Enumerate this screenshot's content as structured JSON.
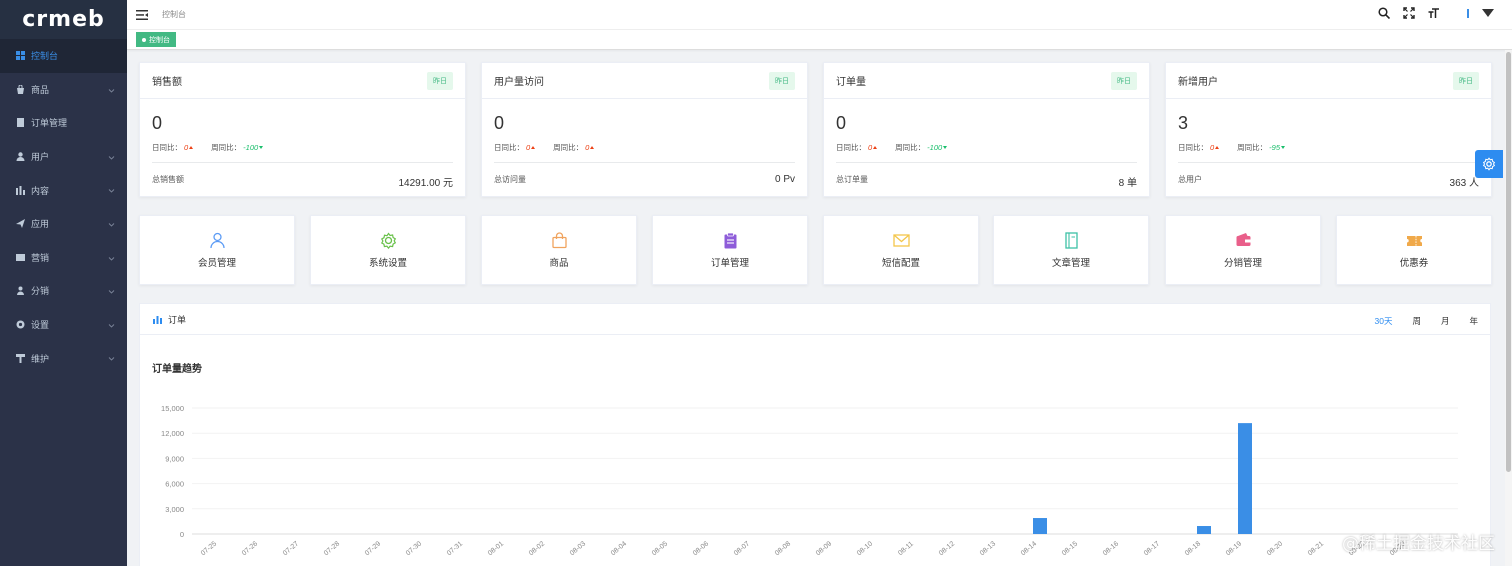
{
  "app": {
    "logo_text": "crmeb"
  },
  "sidebar": {
    "items": [
      {
        "label": "控制台",
        "icon": "dashboard-icon",
        "active": true,
        "has_children": false
      },
      {
        "label": "商品",
        "icon": "shop-icon",
        "has_children": true
      },
      {
        "label": "订单管理",
        "icon": "order-icon",
        "has_children": false
      },
      {
        "label": "用户",
        "icon": "user-icon",
        "has_children": true
      },
      {
        "label": "内容",
        "icon": "content-icon",
        "has_children": true
      },
      {
        "label": "应用",
        "icon": "app-icon",
        "has_children": true
      },
      {
        "label": "营销",
        "icon": "marketing-icon",
        "has_children": true
      },
      {
        "label": "分销",
        "icon": "distribution-icon",
        "has_children": true
      },
      {
        "label": "设置",
        "icon": "settings-icon",
        "has_children": true
      },
      {
        "label": "维护",
        "icon": "maintenance-icon",
        "has_children": true
      }
    ]
  },
  "topbar": {
    "breadcrumb": "控制台",
    "tag_label": "控制台"
  },
  "stats": [
    {
      "title": "销售额",
      "badge": "昨日",
      "value": "0",
      "day_label": "日同比：",
      "day_value": "0",
      "day_trend": "up",
      "week_label": "周同比：",
      "week_value": "-100",
      "week_trend": "down",
      "total_label": "总销售额",
      "total_value": "14291.00 元"
    },
    {
      "title": "用户量访问",
      "badge": "昨日",
      "value": "0",
      "day_label": "日同比：",
      "day_value": "0",
      "day_trend": "up",
      "week_label": "周同比：",
      "week_value": "0",
      "week_trend": "up",
      "total_label": "总访问量",
      "total_value": "0 Pv"
    },
    {
      "title": "订单量",
      "badge": "昨日",
      "value": "0",
      "day_label": "日同比：",
      "day_value": "0",
      "day_trend": "up",
      "week_label": "周同比：",
      "week_value": "-100",
      "week_trend": "down",
      "total_label": "总订单量",
      "total_value": "8 单"
    },
    {
      "title": "新增用户",
      "badge": "昨日",
      "value": "3",
      "day_label": "日同比：",
      "day_value": "0",
      "day_trend": "up",
      "week_label": "周同比：",
      "week_value": "-95",
      "week_trend": "down",
      "total_label": "总用户",
      "total_value": "363 人"
    }
  ],
  "quick_nav": [
    {
      "label": "会员管理",
      "icon": "member-icon",
      "color": "#5b9bf5"
    },
    {
      "label": "系统设置",
      "icon": "gear-icon",
      "color": "#69c14a"
    },
    {
      "label": "商品",
      "icon": "shopping-bag-icon",
      "color": "#f0a35e"
    },
    {
      "label": "订单管理",
      "icon": "clipboard-icon",
      "color": "#8e5cd9"
    },
    {
      "label": "短信配置",
      "icon": "mail-icon",
      "color": "#f3c64b"
    },
    {
      "label": "文章管理",
      "icon": "notebook-icon",
      "color": "#3dc1a6"
    },
    {
      "label": "分销管理",
      "icon": "wallet-icon",
      "color": "#e95f8a"
    },
    {
      "label": "优惠券",
      "icon": "ticket-icon",
      "color": "#f0a94a"
    }
  ],
  "order_panel": {
    "title": "订单",
    "ranges": [
      "30天",
      "周",
      "月",
      "年"
    ],
    "active_range": "30天",
    "chart_title": "订单量趋势"
  },
  "chart_data": {
    "type": "bar",
    "title": "订单量趋势",
    "categories": [
      "07-25",
      "07-26",
      "07-27",
      "07-28",
      "07-29",
      "07-30",
      "07-31",
      "08-01",
      "08-02",
      "08-03",
      "08-04",
      "08-05",
      "08-06",
      "08-07",
      "08-08",
      "08-09",
      "08-10",
      "08-11",
      "08-12",
      "08-13",
      "08-14",
      "08-15",
      "08-16",
      "08-17",
      "08-18",
      "08-19",
      "08-20",
      "08-21",
      "08-22",
      "08-23"
    ],
    "values": [
      0,
      0,
      0,
      0,
      0,
      0,
      0,
      0,
      0,
      0,
      0,
      0,
      0,
      0,
      0,
      0,
      0,
      0,
      0,
      0,
      1900,
      0,
      0,
      0,
      950,
      13200,
      0,
      0,
      0,
      0
    ],
    "yticks": [
      "0",
      "3,000",
      "6,000",
      "9,000",
      "12,000",
      "15,000"
    ],
    "ylim": [
      0,
      15000
    ],
    "bar_color": "#3a8ee6",
    "grid": true
  },
  "watermark": "@稀土掘金技术社区"
}
